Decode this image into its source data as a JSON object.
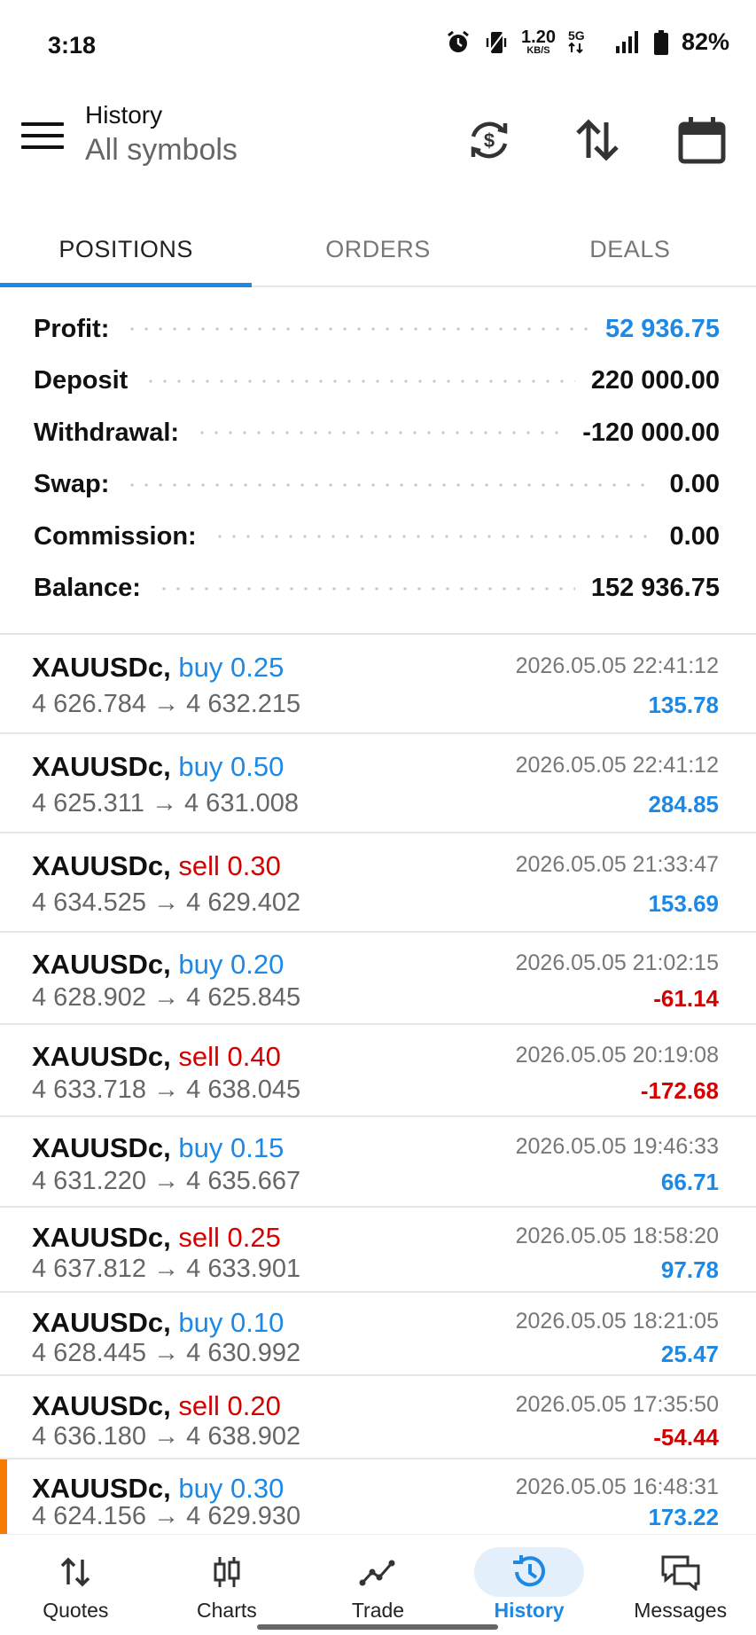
{
  "status_bar": {
    "time": "3:18",
    "net_speed_value": "1.20",
    "net_speed_unit": "KB/S",
    "network_type": "5G",
    "battery": "82%"
  },
  "app_bar": {
    "title": "History",
    "subtitle": "All symbols"
  },
  "tabs": [
    {
      "label": "POSITIONS",
      "active": true
    },
    {
      "label": "ORDERS",
      "active": false
    },
    {
      "label": "DEALS",
      "active": false
    }
  ],
  "summary": [
    {
      "label": "Profit:",
      "value": "52 936.75",
      "highlight": true
    },
    {
      "label": "Deposit",
      "value": "220 000.00",
      "highlight": false
    },
    {
      "label": "Withdrawal:",
      "value": "-120 000.00",
      "highlight": false
    },
    {
      "label": "Swap:",
      "value": "0.00",
      "highlight": false
    },
    {
      "label": "Commission:",
      "value": "0.00",
      "highlight": false
    },
    {
      "label": "Balance:",
      "value": "152 936.75",
      "highlight": false
    }
  ],
  "positions": [
    {
      "symbol": "XAUUSDc,",
      "side": "buy",
      "volume": "0.25",
      "open": "4 626.784",
      "close": "4 632.215",
      "time": "2026.05.05 22:41:12",
      "profit": "135.78"
    },
    {
      "symbol": "XAUUSDc,",
      "side": "buy",
      "volume": "0.50",
      "open": "4 625.311",
      "close": "4 631.008",
      "time": "2026.05.05 22:41:12",
      "profit": "284.85"
    },
    {
      "symbol": "XAUUSDc,",
      "side": "sell",
      "volume": "0.30",
      "open": "4 634.525",
      "close": "4 629.402",
      "time": "2026.05.05 21:33:47",
      "profit": "153.69"
    },
    {
      "symbol": "XAUUSDc,",
      "side": "buy",
      "volume": "0.20",
      "open": "4 628.902",
      "close": "4 625.845",
      "time": "2026.05.05 21:02:15",
      "profit": "-61.14"
    },
    {
      "symbol": "XAUUSDc,",
      "side": "sell",
      "volume": "0.40",
      "open": "4 633.718",
      "close": "4 638.045",
      "time": "2026.05.05 20:19:08",
      "profit": "-172.68"
    },
    {
      "symbol": "XAUUSDc,",
      "side": "buy",
      "volume": "0.15",
      "open": "4 631.220",
      "close": "4 635.667",
      "time": "2026.05.05 19:46:33",
      "profit": "66.71"
    },
    {
      "symbol": "XAUUSDc,",
      "side": "sell",
      "volume": "0.25",
      "open": "4 637.812",
      "close": "4 633.901",
      "time": "2026.05.05 18:58:20",
      "profit": "97.78"
    },
    {
      "symbol": "XAUUSDc,",
      "side": "buy",
      "volume": "0.10",
      "open": "4 628.445",
      "close": "4 630.992",
      "time": "2026.05.05 18:21:05",
      "profit": "25.47"
    },
    {
      "symbol": "XAUUSDc,",
      "side": "sell",
      "volume": "0.20",
      "open": "4 636.180",
      "close": "4 638.902",
      "time": "2026.05.05 17:35:50",
      "profit": "-54.44"
    },
    {
      "symbol": "XAUUSDc,",
      "side": "buy",
      "volume": "0.30",
      "open": "4 624.156",
      "close": "4 629.930",
      "time": "2026.05.05 16:48:31",
      "profit": "173.22",
      "marked": true
    }
  ],
  "bottom_nav": [
    {
      "label": "Quotes",
      "icon": "quotes-arrows-icon",
      "active": false
    },
    {
      "label": "Charts",
      "icon": "candlestick-icon",
      "active": false
    },
    {
      "label": "Trade",
      "icon": "trade-line-icon",
      "active": false
    },
    {
      "label": "History",
      "icon": "history-clock-icon",
      "active": true
    },
    {
      "label": "Messages",
      "icon": "chat-bubbles-icon",
      "active": false
    }
  ],
  "colors": {
    "accent_blue": "#1e88e5",
    "sell_red": "#d50000",
    "marker_orange": "#f57c00"
  }
}
